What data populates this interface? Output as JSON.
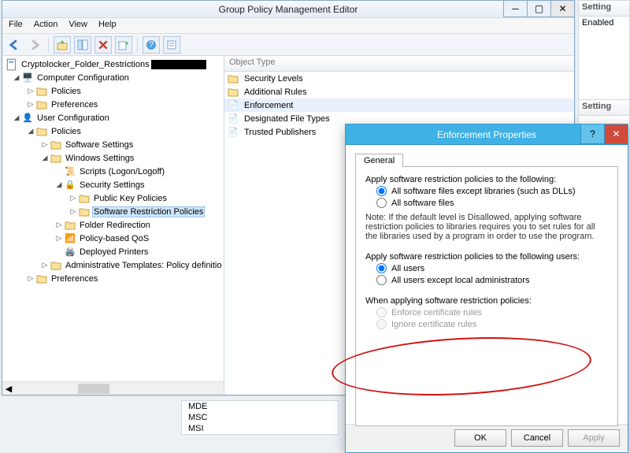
{
  "main_window": {
    "title": "Group Policy Management Editor",
    "menu": [
      "File",
      "Action",
      "View",
      "Help"
    ],
    "tree_root": "Cryptolocker_Folder_Restrictions",
    "tree": {
      "cc": "Computer Configuration",
      "cc_pol": "Policies",
      "cc_pref": "Preferences",
      "uc": "User Configuration",
      "uc_pol": "Policies",
      "uc_ss": "Software Settings",
      "uc_ws": "Windows Settings",
      "uc_scr": "Scripts (Logon/Logoff)",
      "uc_sec": "Security Settings",
      "uc_pkp": "Public Key Policies",
      "uc_srp": "Software Restriction Policies",
      "uc_fr": "Folder Redirection",
      "uc_qos": "Policy-based QoS",
      "uc_dp": "Deployed Printers",
      "uc_adm": "Administrative Templates: Policy definitio",
      "uc_pref": "Preferences"
    },
    "list_header": "Object Type",
    "list_items": [
      "Security Levels",
      "Additional Rules",
      "Enforcement",
      "Designated File Types",
      "Trusted Publishers"
    ],
    "list_selected_index": 2
  },
  "side_panel": {
    "header1": "Setting",
    "value1": "Enabled",
    "header2": "Setting"
  },
  "dialog": {
    "title": "Enforcement Properties",
    "tab": "General",
    "group1_label": "Apply software restriction policies to the following:",
    "opt1a": "All software files except libraries (such as DLLs)",
    "opt1b": "All software files",
    "note": "Note:   If the default level is Disallowed, applying software restriction policies to libraries requires you to set rules for all the libraries used by a program in order to use the program.",
    "group2_label": "Apply software restriction policies to the following users:",
    "opt2a": "All users",
    "opt2b": "All users except local administrators",
    "group3_label": "When applying software restriction policies:",
    "opt3a": "Enforce certificate rules",
    "opt3b": "Ignore certificate rules",
    "buttons": {
      "ok": "OK",
      "cancel": "Cancel",
      "apply": "Apply"
    }
  },
  "extra_list": [
    "MDE",
    "MSC",
    "MSI"
  ]
}
